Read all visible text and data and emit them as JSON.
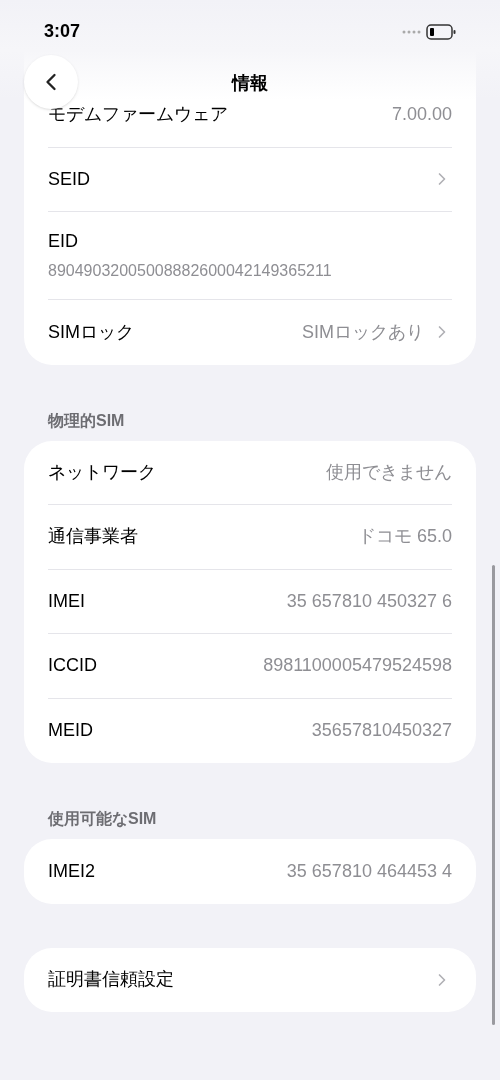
{
  "status_bar": {
    "time": "3:07"
  },
  "header": {
    "title": "情報"
  },
  "sections": [
    {
      "rows": [
        {
          "kind": "value",
          "label": "モデムファームウェア",
          "value": "7.00.00"
        },
        {
          "kind": "link",
          "label": "SEID"
        },
        {
          "kind": "stacked",
          "label": "EID",
          "value": "89049032005008882600042149365211"
        },
        {
          "kind": "link",
          "label": "SIMロック",
          "value": "SIMロックあり"
        }
      ]
    },
    {
      "title": "物理的SIM",
      "rows": [
        {
          "kind": "value",
          "label": "ネットワーク",
          "value": "使用できません"
        },
        {
          "kind": "value",
          "label": "通信事業者",
          "value": "ドコモ 65.0"
        },
        {
          "kind": "value",
          "label": "IMEI",
          "value": "35 657810 450327 6"
        },
        {
          "kind": "value",
          "label": "ICCID",
          "value": "8981100005479524598"
        },
        {
          "kind": "value",
          "label": "MEID",
          "value": "35657810450327"
        }
      ]
    },
    {
      "title": "使用可能なSIM",
      "rows": [
        {
          "kind": "value",
          "label": "IMEI2",
          "value": "35 657810 464453 4"
        }
      ]
    },
    {
      "rows": [
        {
          "kind": "link",
          "label": "証明書信頼設定"
        }
      ]
    }
  ]
}
